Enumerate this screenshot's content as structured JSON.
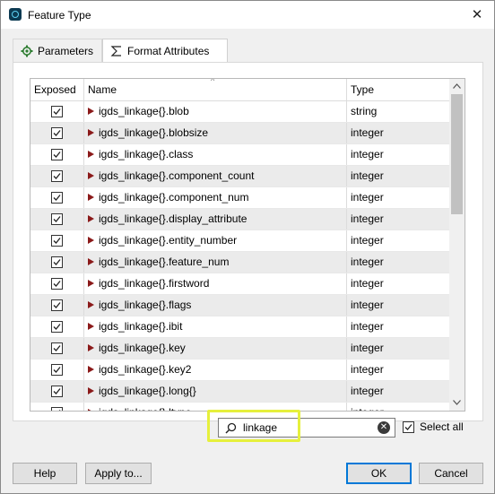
{
  "window": {
    "title": "Feature Type",
    "close_glyph": "✕"
  },
  "tabs": [
    {
      "label": "Parameters",
      "icon": "gear-icon",
      "active": false
    },
    {
      "label": "Format Attributes",
      "icon": "sigma-icon",
      "active": true
    }
  ],
  "table": {
    "columns": {
      "exposed": "Exposed",
      "name": "Name",
      "type": "Type"
    },
    "sort_indicator": "^",
    "rows": [
      {
        "exposed": true,
        "name": "igds_linkage{}.blob",
        "type": "string"
      },
      {
        "exposed": true,
        "name": "igds_linkage{}.blobsize",
        "type": "integer"
      },
      {
        "exposed": true,
        "name": "igds_linkage{}.class",
        "type": "integer"
      },
      {
        "exposed": true,
        "name": "igds_linkage{}.component_count",
        "type": "integer"
      },
      {
        "exposed": true,
        "name": "igds_linkage{}.component_num",
        "type": "integer"
      },
      {
        "exposed": true,
        "name": "igds_linkage{}.display_attribute",
        "type": "integer"
      },
      {
        "exposed": true,
        "name": "igds_linkage{}.entity_number",
        "type": "integer"
      },
      {
        "exposed": true,
        "name": "igds_linkage{}.feature_num",
        "type": "integer"
      },
      {
        "exposed": true,
        "name": "igds_linkage{}.firstword",
        "type": "integer"
      },
      {
        "exposed": true,
        "name": "igds_linkage{}.flags",
        "type": "integer"
      },
      {
        "exposed": true,
        "name": "igds_linkage{}.ibit",
        "type": "integer"
      },
      {
        "exposed": true,
        "name": "igds_linkage{}.key",
        "type": "integer"
      },
      {
        "exposed": true,
        "name": "igds_linkage{}.key2",
        "type": "integer"
      },
      {
        "exposed": true,
        "name": "igds_linkage{}.long{}",
        "type": "integer"
      },
      {
        "exposed": true,
        "name": "igds_linkage{}.ltype",
        "type": "integer"
      }
    ]
  },
  "filter": {
    "value": "linkage",
    "placeholder": "",
    "select_all_label": "Select all",
    "select_all_checked": true
  },
  "buttons": {
    "help": "Help",
    "apply_to": "Apply to...",
    "ok": "OK",
    "cancel": "Cancel"
  },
  "colors": {
    "row_alt": "#ebebeb",
    "expand_arrow": "#8b1a1a",
    "highlight": "#e6f03c",
    "default_button_border": "#0078d7"
  }
}
